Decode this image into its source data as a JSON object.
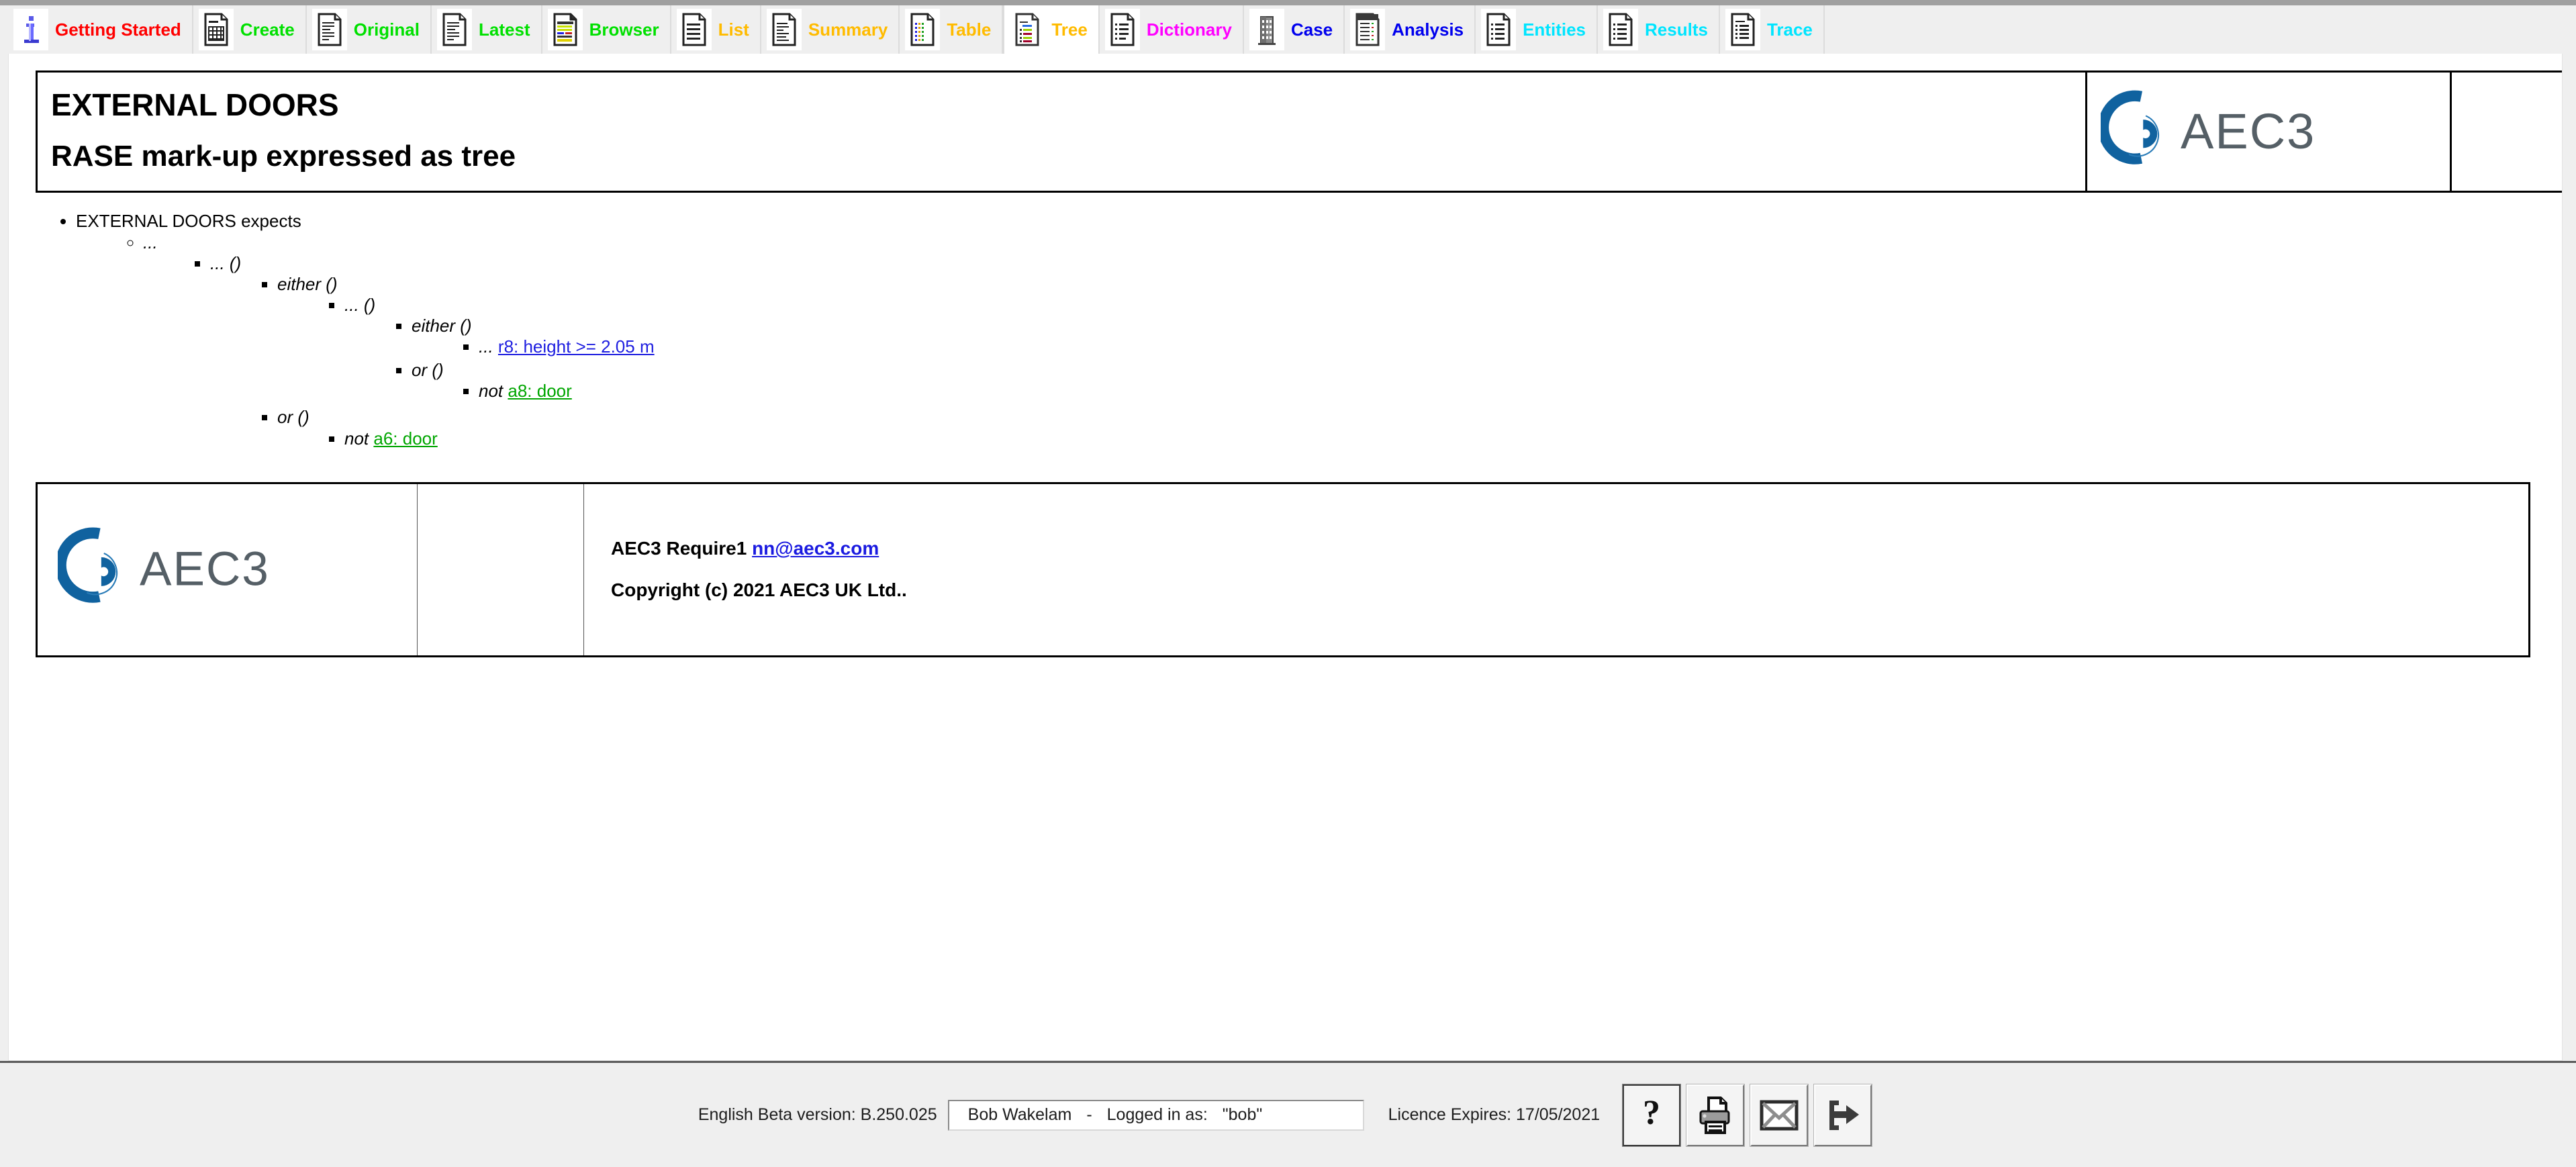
{
  "tabs": [
    {
      "label": "Getting Started",
      "color": "#ff0000",
      "icon": "info-icon",
      "selected": false
    },
    {
      "label": "Create",
      "color": "#00e000",
      "icon": "grid-document-icon",
      "selected": false
    },
    {
      "label": "Original",
      "color": "#00e000",
      "icon": "text-document-icon",
      "selected": false
    },
    {
      "label": "Latest",
      "color": "#00e000",
      "icon": "text-document-icon",
      "selected": false
    },
    {
      "label": "Browser",
      "color": "#00e000",
      "icon": "colored-list-icon",
      "selected": false
    },
    {
      "label": "List",
      "color": "#ffbb00",
      "icon": "lines-document-icon",
      "selected": false
    },
    {
      "label": "Summary",
      "color": "#ffbb00",
      "icon": "summary-document-icon",
      "selected": false
    },
    {
      "label": "Table",
      "color": "#ffbb00",
      "icon": "table-document-icon",
      "selected": false
    },
    {
      "label": "Tree",
      "color": "#ffbb00",
      "icon": "tree-document-icon",
      "selected": true
    },
    {
      "label": "Dictionary",
      "color": "#ff00ff",
      "icon": "dictionary-icon",
      "selected": false
    },
    {
      "label": "Case",
      "color": "#0000ee",
      "icon": "building-icon",
      "selected": false
    },
    {
      "label": "Analysis",
      "color": "#0000ee",
      "icon": "analysis-icon",
      "selected": false
    },
    {
      "label": "Entities",
      "color": "#00e5ff",
      "icon": "entities-icon",
      "selected": false
    },
    {
      "label": "Results",
      "color": "#00e5ff",
      "icon": "results-icon",
      "selected": false
    },
    {
      "label": "Trace",
      "color": "#00e5ff",
      "icon": "trace-icon",
      "selected": false
    }
  ],
  "header": {
    "title": "EXTERNAL DOORS",
    "subtitle": "RASE mark-up expressed as tree",
    "logo_text": "AEC 3"
  },
  "tree": {
    "root": "EXTERNAL DOORS expects",
    "n1": "...",
    "n2": "... ()",
    "n3": "either ()",
    "n4": "... ()",
    "n5": "either ()",
    "n6_prefix": "...",
    "n6_link": "r8: height >= 2.05 m",
    "n7": "or ()",
    "n8_prefix": "not",
    "n8_link": "a8: door",
    "n9": "or ()",
    "n10_prefix": "not",
    "n10_link": "a6: door"
  },
  "footer_panel": {
    "product_prefix": "AEC3 Require1",
    "email": "nn@aec3.com",
    "copyright": "Copyright (c) 2021 AEC3 UK Ltd..",
    "logo_text": "AEC 3"
  },
  "statusbar": {
    "version": "English Beta version: B.250.025",
    "user_name": "Bob Wakelam",
    "separator": "-",
    "logged_in_label": "Logged in as:",
    "logged_in_value": "\"bob\"",
    "licence": "Licence Expires: 17/05/2021",
    "buttons": [
      {
        "name": "help-button",
        "icon": "question-mark-icon"
      },
      {
        "name": "print-button",
        "icon": "printer-icon"
      },
      {
        "name": "email-button",
        "icon": "envelope-icon"
      },
      {
        "name": "logout-button",
        "icon": "exit-arrow-icon"
      }
    ]
  },
  "colors": {
    "brand_blue": "#10629f",
    "brand_gray": "#555f66",
    "link_blue": "#2020e0",
    "link_green": "#00a600",
    "chrome_gray": "#efefef"
  }
}
